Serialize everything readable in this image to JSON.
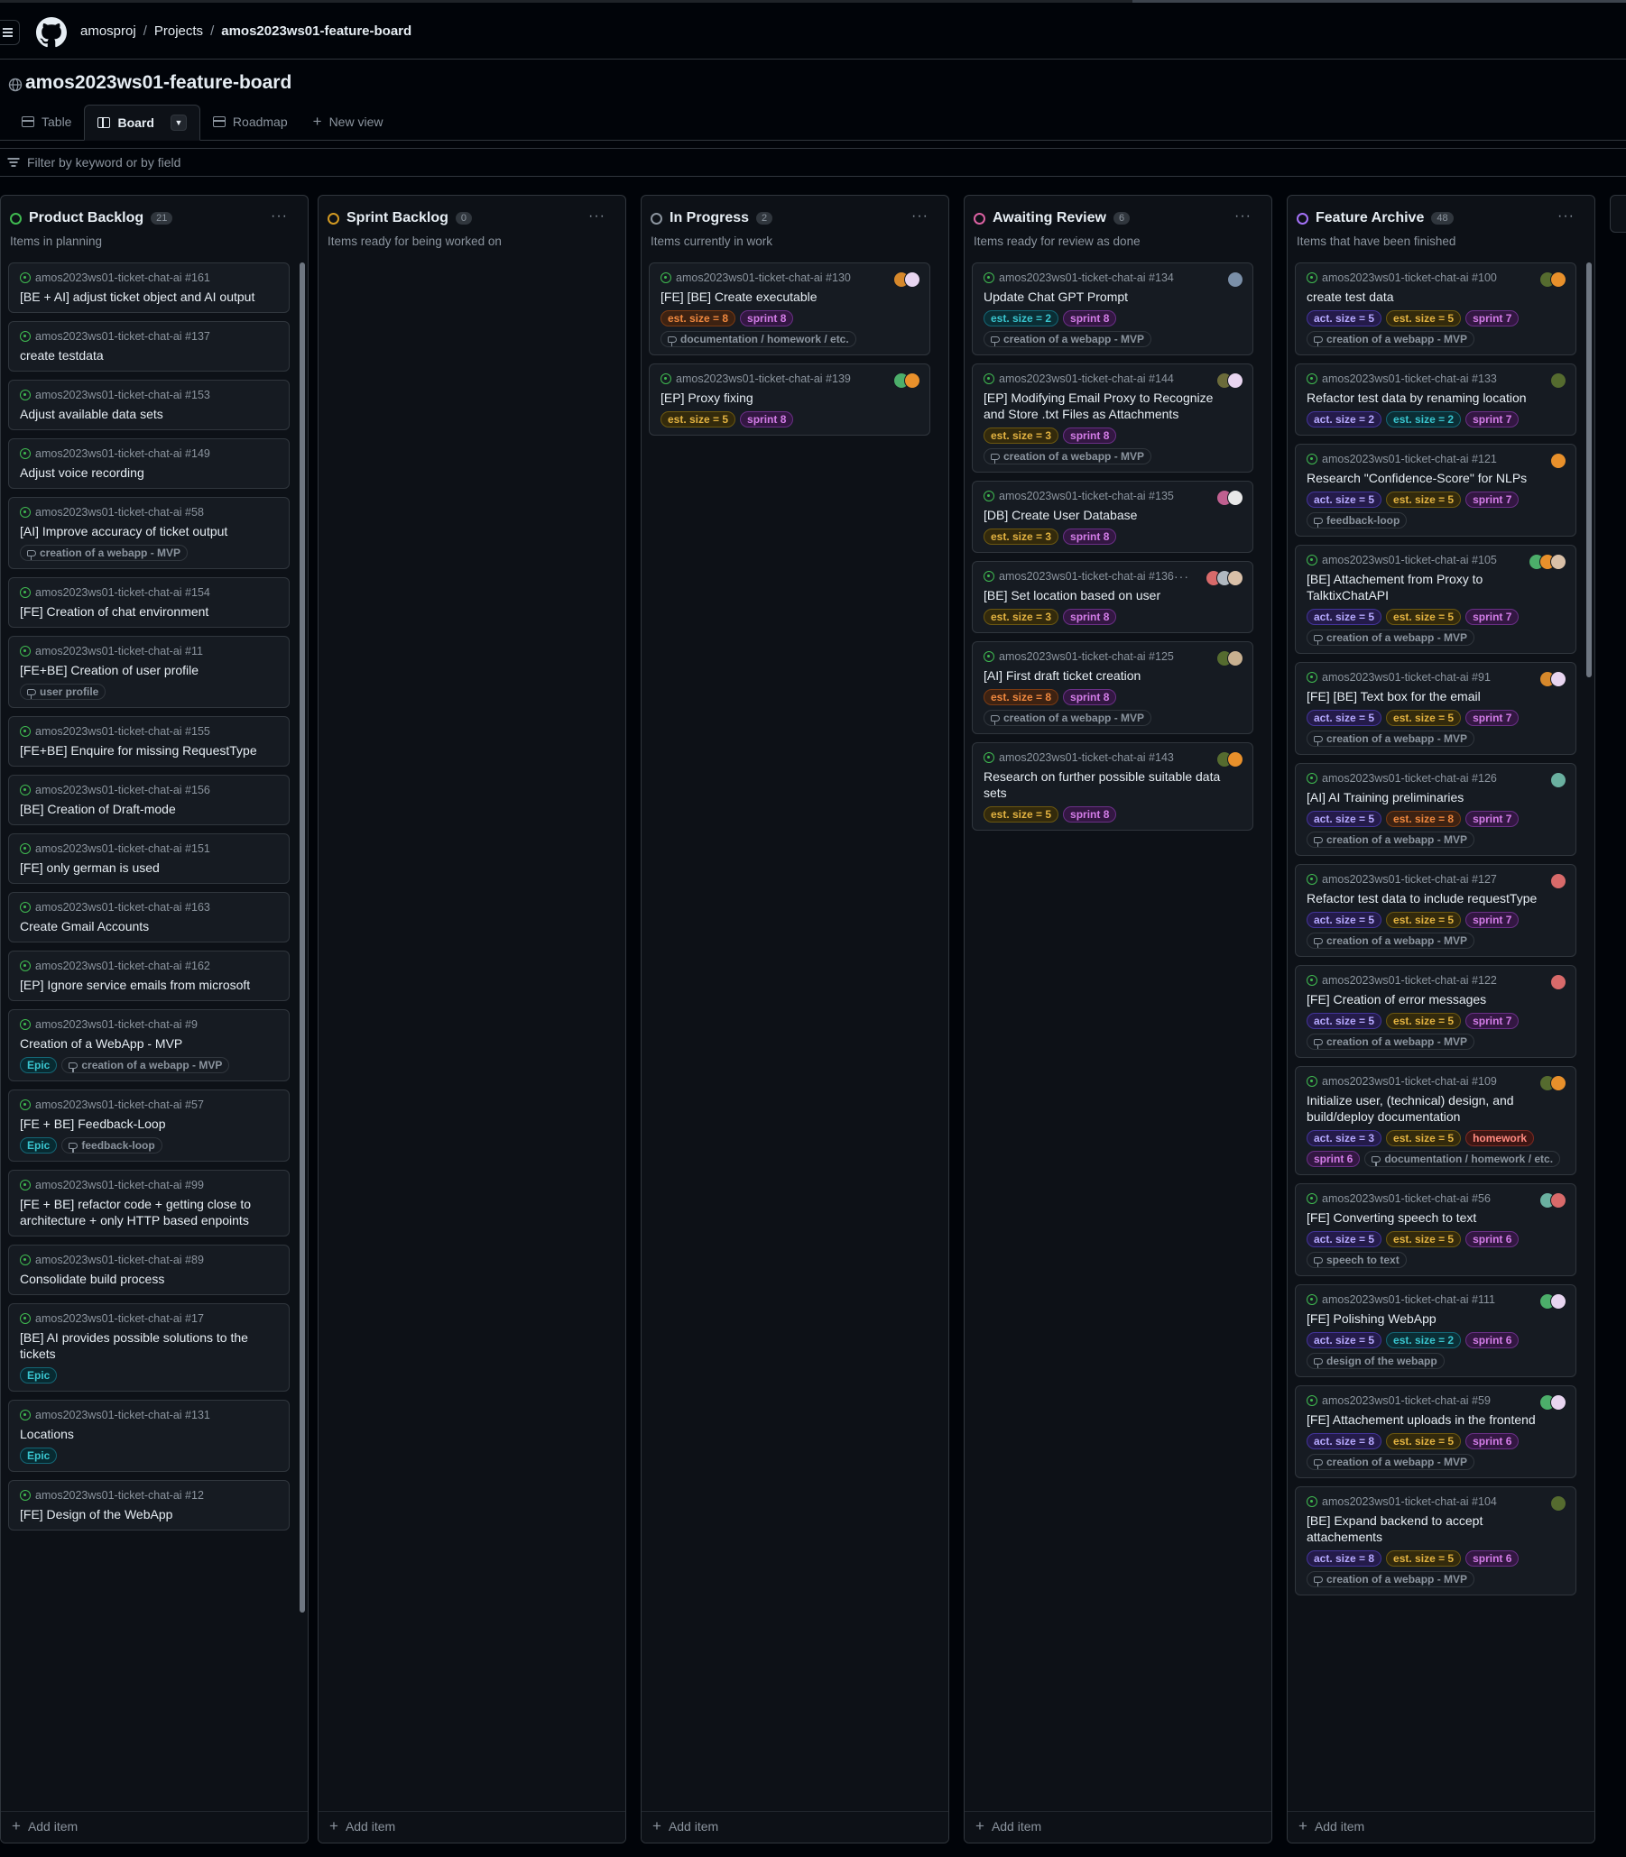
{
  "breadcrumb": {
    "org": "amosproj",
    "sep": "/",
    "projects": "Projects",
    "board": "amos2023ws01-feature-board"
  },
  "project_title": "amos2023ws01-feature-board",
  "views": [
    {
      "label": "Table",
      "icon": "table-icon"
    },
    {
      "label": "Board",
      "icon": "board-icon",
      "active": true
    },
    {
      "label": "Roadmap",
      "icon": "roadmap-icon"
    },
    {
      "label": "New view",
      "icon": "plus-icon"
    }
  ],
  "filter": {
    "placeholder": "Filter by keyword or by field"
  },
  "add_item_label": "Add item",
  "colors": {
    "background": "#010409",
    "column": "#0d1117",
    "card": "#161b22",
    "border": "#30363d",
    "green": "#3fb950",
    "orange": "#d29922",
    "gray": "#8b949e",
    "pink": "#db61a2",
    "purple": "#a371f7"
  },
  "columns": [
    {
      "title": "Product Backlog",
      "count": "21",
      "description": "Items in planning",
      "status_color": "#3fb950",
      "cards": [
        {
          "repo": "amos2023ws01-ticket-chat-ai #161",
          "title": "[BE + AI] adjust ticket object and AI output",
          "labels": []
        },
        {
          "repo": "amos2023ws01-ticket-chat-ai #137",
          "title": "create testdata",
          "labels": []
        },
        {
          "repo": "amos2023ws01-ticket-chat-ai #153",
          "title": "Adjust available data sets",
          "labels": []
        },
        {
          "repo": "amos2023ws01-ticket-chat-ai #149",
          "title": "Adjust voice recording",
          "labels": []
        },
        {
          "repo": "amos2023ws01-ticket-chat-ai #58",
          "title": "[AI] Improve accuracy of ticket output",
          "labels": [],
          "milestone": "creation of a webapp - MVP"
        },
        {
          "repo": "amos2023ws01-ticket-chat-ai #154",
          "title": "[FE] Creation of chat environment",
          "labels": []
        },
        {
          "repo": "amos2023ws01-ticket-chat-ai #11",
          "title": "[FE+BE] Creation of user profile",
          "labels": [],
          "milestone": "user profile"
        },
        {
          "repo": "amos2023ws01-ticket-chat-ai #155",
          "title": "[FE+BE] Enquire for missing RequestType",
          "labels": []
        },
        {
          "repo": "amos2023ws01-ticket-chat-ai #156",
          "title": "[BE] Creation of Draft-mode",
          "labels": []
        },
        {
          "repo": "amos2023ws01-ticket-chat-ai #151",
          "title": "[FE] only german is used",
          "labels": []
        },
        {
          "repo": "amos2023ws01-ticket-chat-ai #163",
          "title": "Create Gmail Accounts",
          "labels": []
        },
        {
          "repo": "amos2023ws01-ticket-chat-ai #162",
          "title": "[EP] Ignore service emails from microsoft",
          "labels": []
        },
        {
          "repo": "amos2023ws01-ticket-chat-ai #9",
          "title": "Creation of a WebApp - MVP",
          "labels": [
            {
              "text": "Epic",
              "cls": "lbl-epic"
            }
          ],
          "milestone": "creation of a webapp - MVP"
        },
        {
          "repo": "amos2023ws01-ticket-chat-ai #57",
          "title": "[FE + BE] Feedback-Loop",
          "labels": [
            {
              "text": "Epic",
              "cls": "lbl-epic"
            }
          ],
          "milestone": "feedback-loop"
        },
        {
          "repo": "amos2023ws01-ticket-chat-ai #99",
          "title": "[FE + BE] refactor code + getting close to architecture + only HTTP based enpoints",
          "labels": []
        },
        {
          "repo": "amos2023ws01-ticket-chat-ai #89",
          "title": "Consolidate build process",
          "labels": []
        },
        {
          "repo": "amos2023ws01-ticket-chat-ai #17",
          "title": "[BE] AI provides possible solutions to the tickets",
          "labels": [
            {
              "text": "Epic",
              "cls": "lbl-epic"
            }
          ]
        },
        {
          "repo": "amos2023ws01-ticket-chat-ai #131",
          "title": "Locations",
          "labels": [
            {
              "text": "Epic",
              "cls": "lbl-epic"
            }
          ]
        },
        {
          "repo": "amos2023ws01-ticket-chat-ai #12",
          "title": "[FE] Design of the WebApp",
          "labels": []
        }
      ]
    },
    {
      "title": "Sprint Backlog",
      "count": "0",
      "description": "Items ready for being worked on",
      "status_color": "#d29922",
      "cards": []
    },
    {
      "title": "In Progress",
      "count": "2",
      "description": "Items currently in work",
      "status_color": "#8b949e",
      "cards": [
        {
          "repo": "amos2023ws01-ticket-chat-ai #130",
          "title": "[FE] [BE] Create executable",
          "labels": [
            {
              "text": "est. size = 8",
              "cls": "lbl-est8"
            },
            {
              "text": "sprint 8",
              "cls": "lbl-sprint"
            }
          ],
          "milestone": "documentation / homework / etc.",
          "avatars": [
            "#d6882b",
            "#e8d5f0"
          ]
        },
        {
          "repo": "amos2023ws01-ticket-chat-ai #139",
          "title": "[EP] Proxy fixing",
          "labels": [
            {
              "text": "est. size = 5",
              "cls": "lbl-est5"
            },
            {
              "text": "sprint 8",
              "cls": "lbl-sprint"
            }
          ],
          "avatars": [
            "#4cae6a",
            "#e8902b"
          ]
        }
      ]
    },
    {
      "title": "Awaiting Review",
      "count": "6",
      "description": "Items ready for review as done",
      "status_color": "#db61a2",
      "cards": [
        {
          "repo": "amos2023ws01-ticket-chat-ai #134",
          "title": "Update Chat GPT Prompt",
          "labels": [
            {
              "text": "est. size = 2",
              "cls": "lbl-est2"
            },
            {
              "text": "sprint 8",
              "cls": "lbl-sprint"
            }
          ],
          "milestone": "creation of a webapp - MVP",
          "avatars": [
            "#7a8fa8"
          ]
        },
        {
          "repo": "amos2023ws01-ticket-chat-ai #144",
          "title": "[EP] Modifying Email Proxy to Recognize and Store .txt Files as Attachments",
          "labels": [
            {
              "text": "est. size = 3",
              "cls": "lbl-est3"
            },
            {
              "text": "sprint 8",
              "cls": "lbl-sprint"
            }
          ],
          "milestone": "creation of a webapp - MVP",
          "avatars": [
            "#6b6b3a",
            "#e8d5f0"
          ]
        },
        {
          "repo": "amos2023ws01-ticket-chat-ai #135",
          "title": "[DB] Create User Database",
          "labels": [
            {
              "text": "est. size = 3",
              "cls": "lbl-est3"
            },
            {
              "text": "sprint 8",
              "cls": "lbl-sprint"
            }
          ],
          "avatars": [
            "#c06090",
            "#e8e8e8"
          ]
        },
        {
          "repo": "amos2023ws01-ticket-chat-ai #136",
          "title": "[BE] Set location based on user",
          "labels": [
            {
              "text": "est. size = 3",
              "cls": "lbl-est3"
            },
            {
              "text": "sprint 8",
              "cls": "lbl-sprint"
            }
          ],
          "avatars": [
            "#d86a6a",
            "#b0b8c0",
            "#d9c0a8"
          ],
          "more": true
        },
        {
          "repo": "amos2023ws01-ticket-chat-ai #125",
          "title": "[AI] First draft ticket creation",
          "labels": [
            {
              "text": "est. size = 8",
              "cls": "lbl-est8"
            },
            {
              "text": "sprint 8",
              "cls": "lbl-sprint"
            }
          ],
          "milestone": "creation of a webapp - MVP",
          "avatars": [
            "#556b2f",
            "#c8b090"
          ]
        },
        {
          "repo": "amos2023ws01-ticket-chat-ai #143",
          "title": "Research on further possible suitable data sets",
          "labels": [
            {
              "text": "est. size = 5",
              "cls": "lbl-est5"
            },
            {
              "text": "sprint 8",
              "cls": "lbl-sprint"
            }
          ],
          "avatars": [
            "#556b2f",
            "#e8902b"
          ]
        }
      ]
    },
    {
      "title": "Feature Archive",
      "count": "48",
      "description": "Items that have been finished",
      "status_color": "#a371f7",
      "cards": [
        {
          "repo": "amos2023ws01-ticket-chat-ai #100",
          "title": "create test data",
          "labels": [
            {
              "text": "act. size = 5",
              "cls": "lbl-act"
            },
            {
              "text": "est. size = 5",
              "cls": "lbl-est5"
            },
            {
              "text": "sprint 7",
              "cls": "lbl-sprint"
            }
          ],
          "milestone": "creation of a webapp - MVP",
          "avatars": [
            "#556b2f",
            "#e8902b"
          ]
        },
        {
          "repo": "amos2023ws01-ticket-chat-ai #133",
          "title": "Refactor test data by renaming location",
          "labels": [
            {
              "text": "act. size = 2",
              "cls": "lbl-act"
            },
            {
              "text": "est. size = 2",
              "cls": "lbl-est2"
            },
            {
              "text": "sprint 7",
              "cls": "lbl-sprint"
            }
          ],
          "avatars": [
            "#556b2f"
          ]
        },
        {
          "repo": "amos2023ws01-ticket-chat-ai #121",
          "title": "Research \"Confidence-Score\" for NLPs",
          "labels": [
            {
              "text": "act. size = 5",
              "cls": "lbl-act"
            },
            {
              "text": "est. size = 5",
              "cls": "lbl-est5"
            },
            {
              "text": "sprint 7",
              "cls": "lbl-sprint"
            }
          ],
          "milestone": "feedback-loop",
          "avatars": [
            "#e8902b"
          ]
        },
        {
          "repo": "amos2023ws01-ticket-chat-ai #105",
          "title": "[BE] Attachement from Proxy to TalktixChatAPI",
          "labels": [
            {
              "text": "act. size = 5",
              "cls": "lbl-act"
            },
            {
              "text": "est. size = 5",
              "cls": "lbl-est5"
            },
            {
              "text": "sprint 7",
              "cls": "lbl-sprint"
            }
          ],
          "milestone": "creation of a webapp - MVP",
          "avatars": [
            "#4cae6a",
            "#e8902b",
            "#d9c0a8"
          ]
        },
        {
          "repo": "amos2023ws01-ticket-chat-ai #91",
          "title": "[FE] [BE] Text box for the email",
          "labels": [
            {
              "text": "act. size = 5",
              "cls": "lbl-act"
            },
            {
              "text": "est. size = 5",
              "cls": "lbl-est5"
            },
            {
              "text": "sprint 7",
              "cls": "lbl-sprint"
            }
          ],
          "milestone": "creation of a webapp - MVP",
          "avatars": [
            "#d6882b",
            "#e8d5f0"
          ]
        },
        {
          "repo": "amos2023ws01-ticket-chat-ai #126",
          "title": "[AI] AI Training preliminaries",
          "labels": [
            {
              "text": "act. size = 5",
              "cls": "lbl-act"
            },
            {
              "text": "est. size = 8",
              "cls": "lbl-est8"
            },
            {
              "text": "sprint 7",
              "cls": "lbl-sprint"
            }
          ],
          "milestone": "creation of a webapp - MVP",
          "avatars": [
            "#6ab0a0"
          ]
        },
        {
          "repo": "amos2023ws01-ticket-chat-ai #127",
          "title": "Refactor test data to include requestType",
          "labels": [
            {
              "text": "act. size = 5",
              "cls": "lbl-act"
            },
            {
              "text": "est. size = 5",
              "cls": "lbl-est5"
            },
            {
              "text": "sprint 7",
              "cls": "lbl-sprint"
            }
          ],
          "milestone": "creation of a webapp - MVP",
          "avatars": [
            "#d86a6a"
          ]
        },
        {
          "repo": "amos2023ws01-ticket-chat-ai #122",
          "title": "[FE] Creation of error messages",
          "labels": [
            {
              "text": "act. size = 5",
              "cls": "lbl-act"
            },
            {
              "text": "est. size = 5",
              "cls": "lbl-est5"
            },
            {
              "text": "sprint 7",
              "cls": "lbl-sprint"
            }
          ],
          "milestone": "creation of a webapp - MVP",
          "avatars": [
            "#d86a6a"
          ]
        },
        {
          "repo": "amos2023ws01-ticket-chat-ai #109",
          "title": "Initialize user, (technical) design, and build/deploy documentation",
          "labels": [
            {
              "text": "act. size = 3",
              "cls": "lbl-act"
            },
            {
              "text": "est. size = 5",
              "cls": "lbl-est5"
            },
            {
              "text": "homework",
              "cls": "lbl-home"
            },
            {
              "text": "sprint 6",
              "cls": "lbl-sprint"
            }
          ],
          "milestone": "documentation / homework / etc.",
          "avatars": [
            "#556b2f",
            "#e8902b"
          ]
        },
        {
          "repo": "amos2023ws01-ticket-chat-ai #56",
          "title": "[FE] Converting speech to text",
          "labels": [
            {
              "text": "act. size = 5",
              "cls": "lbl-act"
            },
            {
              "text": "est. size = 5",
              "cls": "lbl-est5"
            },
            {
              "text": "sprint 6",
              "cls": "lbl-sprint"
            }
          ],
          "milestone": "speech to text",
          "avatars": [
            "#6ab0a0",
            "#d86a6a"
          ]
        },
        {
          "repo": "amos2023ws01-ticket-chat-ai #111",
          "title": "[FE] Polishing WebApp",
          "labels": [
            {
              "text": "act. size = 5",
              "cls": "lbl-act"
            },
            {
              "text": "est. size = 2",
              "cls": "lbl-est2"
            },
            {
              "text": "sprint 6",
              "cls": "lbl-sprint"
            }
          ],
          "milestone": "design of the webapp",
          "avatars": [
            "#4cae6a",
            "#e8d5f0"
          ]
        },
        {
          "repo": "amos2023ws01-ticket-chat-ai #59",
          "title": "[FE] Attachement uploads in the frontend",
          "labels": [
            {
              "text": "act. size = 8",
              "cls": "lbl-act"
            },
            {
              "text": "est. size = 5",
              "cls": "lbl-est5"
            },
            {
              "text": "sprint 6",
              "cls": "lbl-sprint"
            }
          ],
          "milestone": "creation of a webapp - MVP",
          "avatars": [
            "#4cae6a",
            "#e8d5f0"
          ]
        },
        {
          "repo": "amos2023ws01-ticket-chat-ai #104",
          "title": "[BE] Expand backend to accept attachements",
          "labels": [
            {
              "text": "act. size = 8",
              "cls": "lbl-act"
            },
            {
              "text": "est. size = 5",
              "cls": "lbl-est5"
            },
            {
              "text": "sprint 6",
              "cls": "lbl-sprint"
            }
          ],
          "milestone": "creation of a webapp - MVP",
          "avatars": [
            "#556b2f"
          ]
        }
      ]
    }
  ]
}
